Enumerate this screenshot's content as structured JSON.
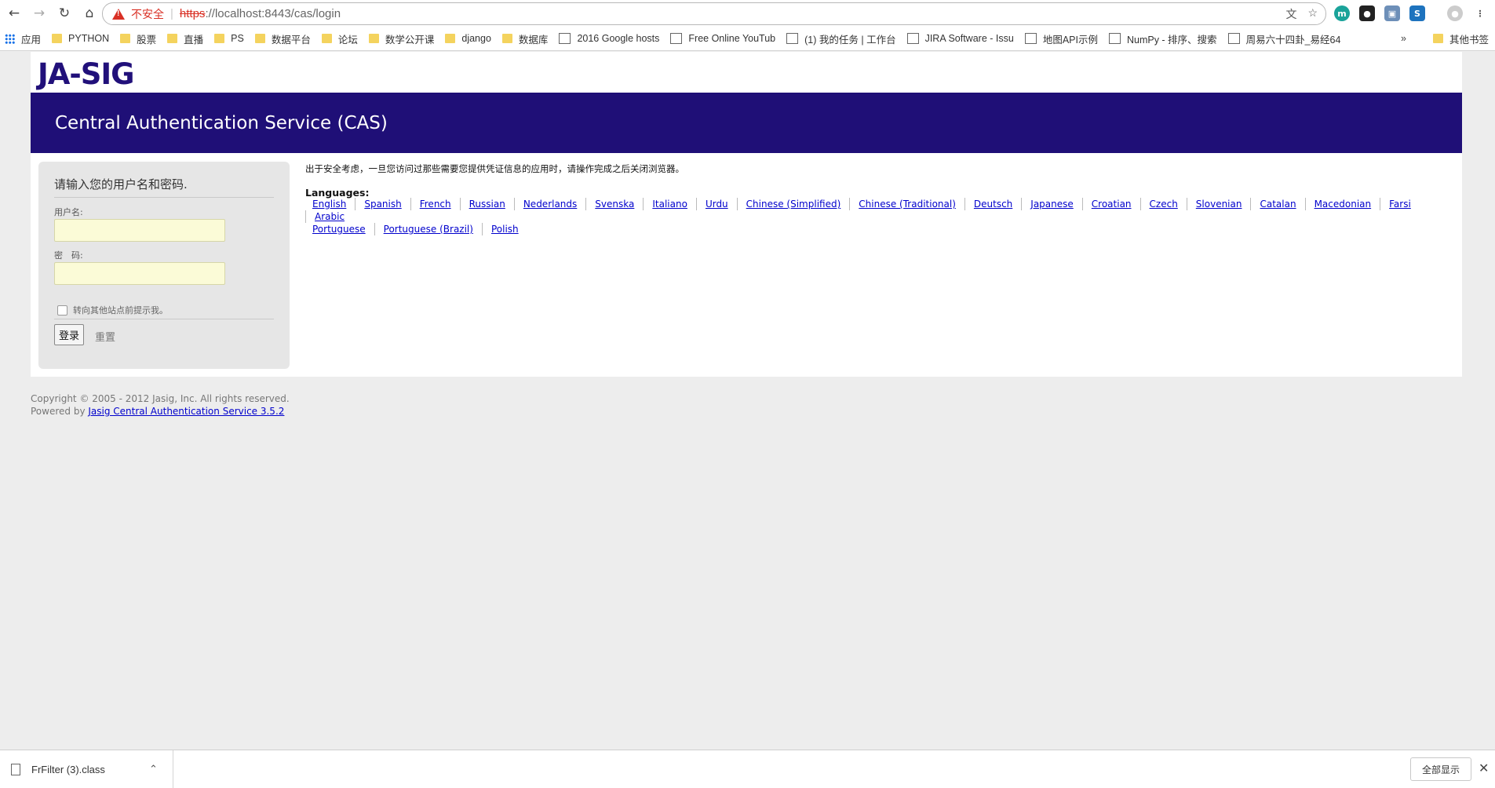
{
  "browser": {
    "insecure_label": "不安全",
    "url_scheme": "https",
    "url_rest": "://localhost:8443/cas/login",
    "bookmarks": [
      {
        "label": "应用",
        "type": "apps"
      },
      {
        "label": "PYTHON",
        "type": "folder"
      },
      {
        "label": "股票",
        "type": "folder"
      },
      {
        "label": "直播",
        "type": "folder"
      },
      {
        "label": "PS",
        "type": "folder"
      },
      {
        "label": "数据平台",
        "type": "folder"
      },
      {
        "label": "论坛",
        "type": "folder"
      },
      {
        "label": "数学公开课",
        "type": "folder"
      },
      {
        "label": "django",
        "type": "folder"
      },
      {
        "label": "数据库",
        "type": "folder"
      },
      {
        "label": "2016 Google hosts",
        "type": "page"
      },
      {
        "label": "Free Online YouTub",
        "type": "page"
      },
      {
        "label": "(1) 我的任务 | 工作台",
        "type": "page"
      },
      {
        "label": "JIRA Software - Issu",
        "type": "page"
      },
      {
        "label": "地图API示例",
        "type": "page"
      },
      {
        "label": "NumPy - 排序、搜索",
        "type": "page"
      },
      {
        "label": "周易六十四卦_易经64",
        "type": "page"
      }
    ],
    "bookmarks_overflow": "»",
    "other_bookmarks": "其他书签"
  },
  "page": {
    "logo": "JA-SIG",
    "banner_title": "Central Authentication Service (CAS)",
    "login": {
      "heading": "请输入您的用户名和密码.",
      "username_label": "用户名:",
      "password_label": "密　码:",
      "warn_label": "转向其他站点前提示我。",
      "submit_label": "登录",
      "reset_label": "重置"
    },
    "notice": "出于安全考虑，一旦您访问过那些需要您提供凭证信息的应用时，请操作完成之后关闭浏览器。",
    "languages_title": "Languages:",
    "languages": [
      "English",
      "Spanish",
      "French",
      "Russian",
      "Nederlands",
      "Svenska",
      "Italiano",
      "Urdu",
      "Chinese (Simplified)",
      "Chinese (Traditional)",
      "Deutsch",
      "Japanese",
      "Croatian",
      "Czech",
      "Slovenian",
      "Catalan",
      "Macedonian",
      "Farsi",
      "Arabic",
      "Portuguese",
      "Portuguese (Brazil)",
      "Polish"
    ],
    "footer": {
      "copyright": "Copyright © 2005 - 2012 Jasig, Inc. All rights reserved.",
      "powered_prefix": "Powered by ",
      "powered_link": "Jasig Central Authentication Service 3.5.2"
    }
  },
  "downloads": {
    "file_name": "FrFilter (3).class",
    "show_all": "全部显示"
  },
  "colors": {
    "banner": "#1f0f77",
    "insecure": "#d93025",
    "link": "#0000cc"
  }
}
